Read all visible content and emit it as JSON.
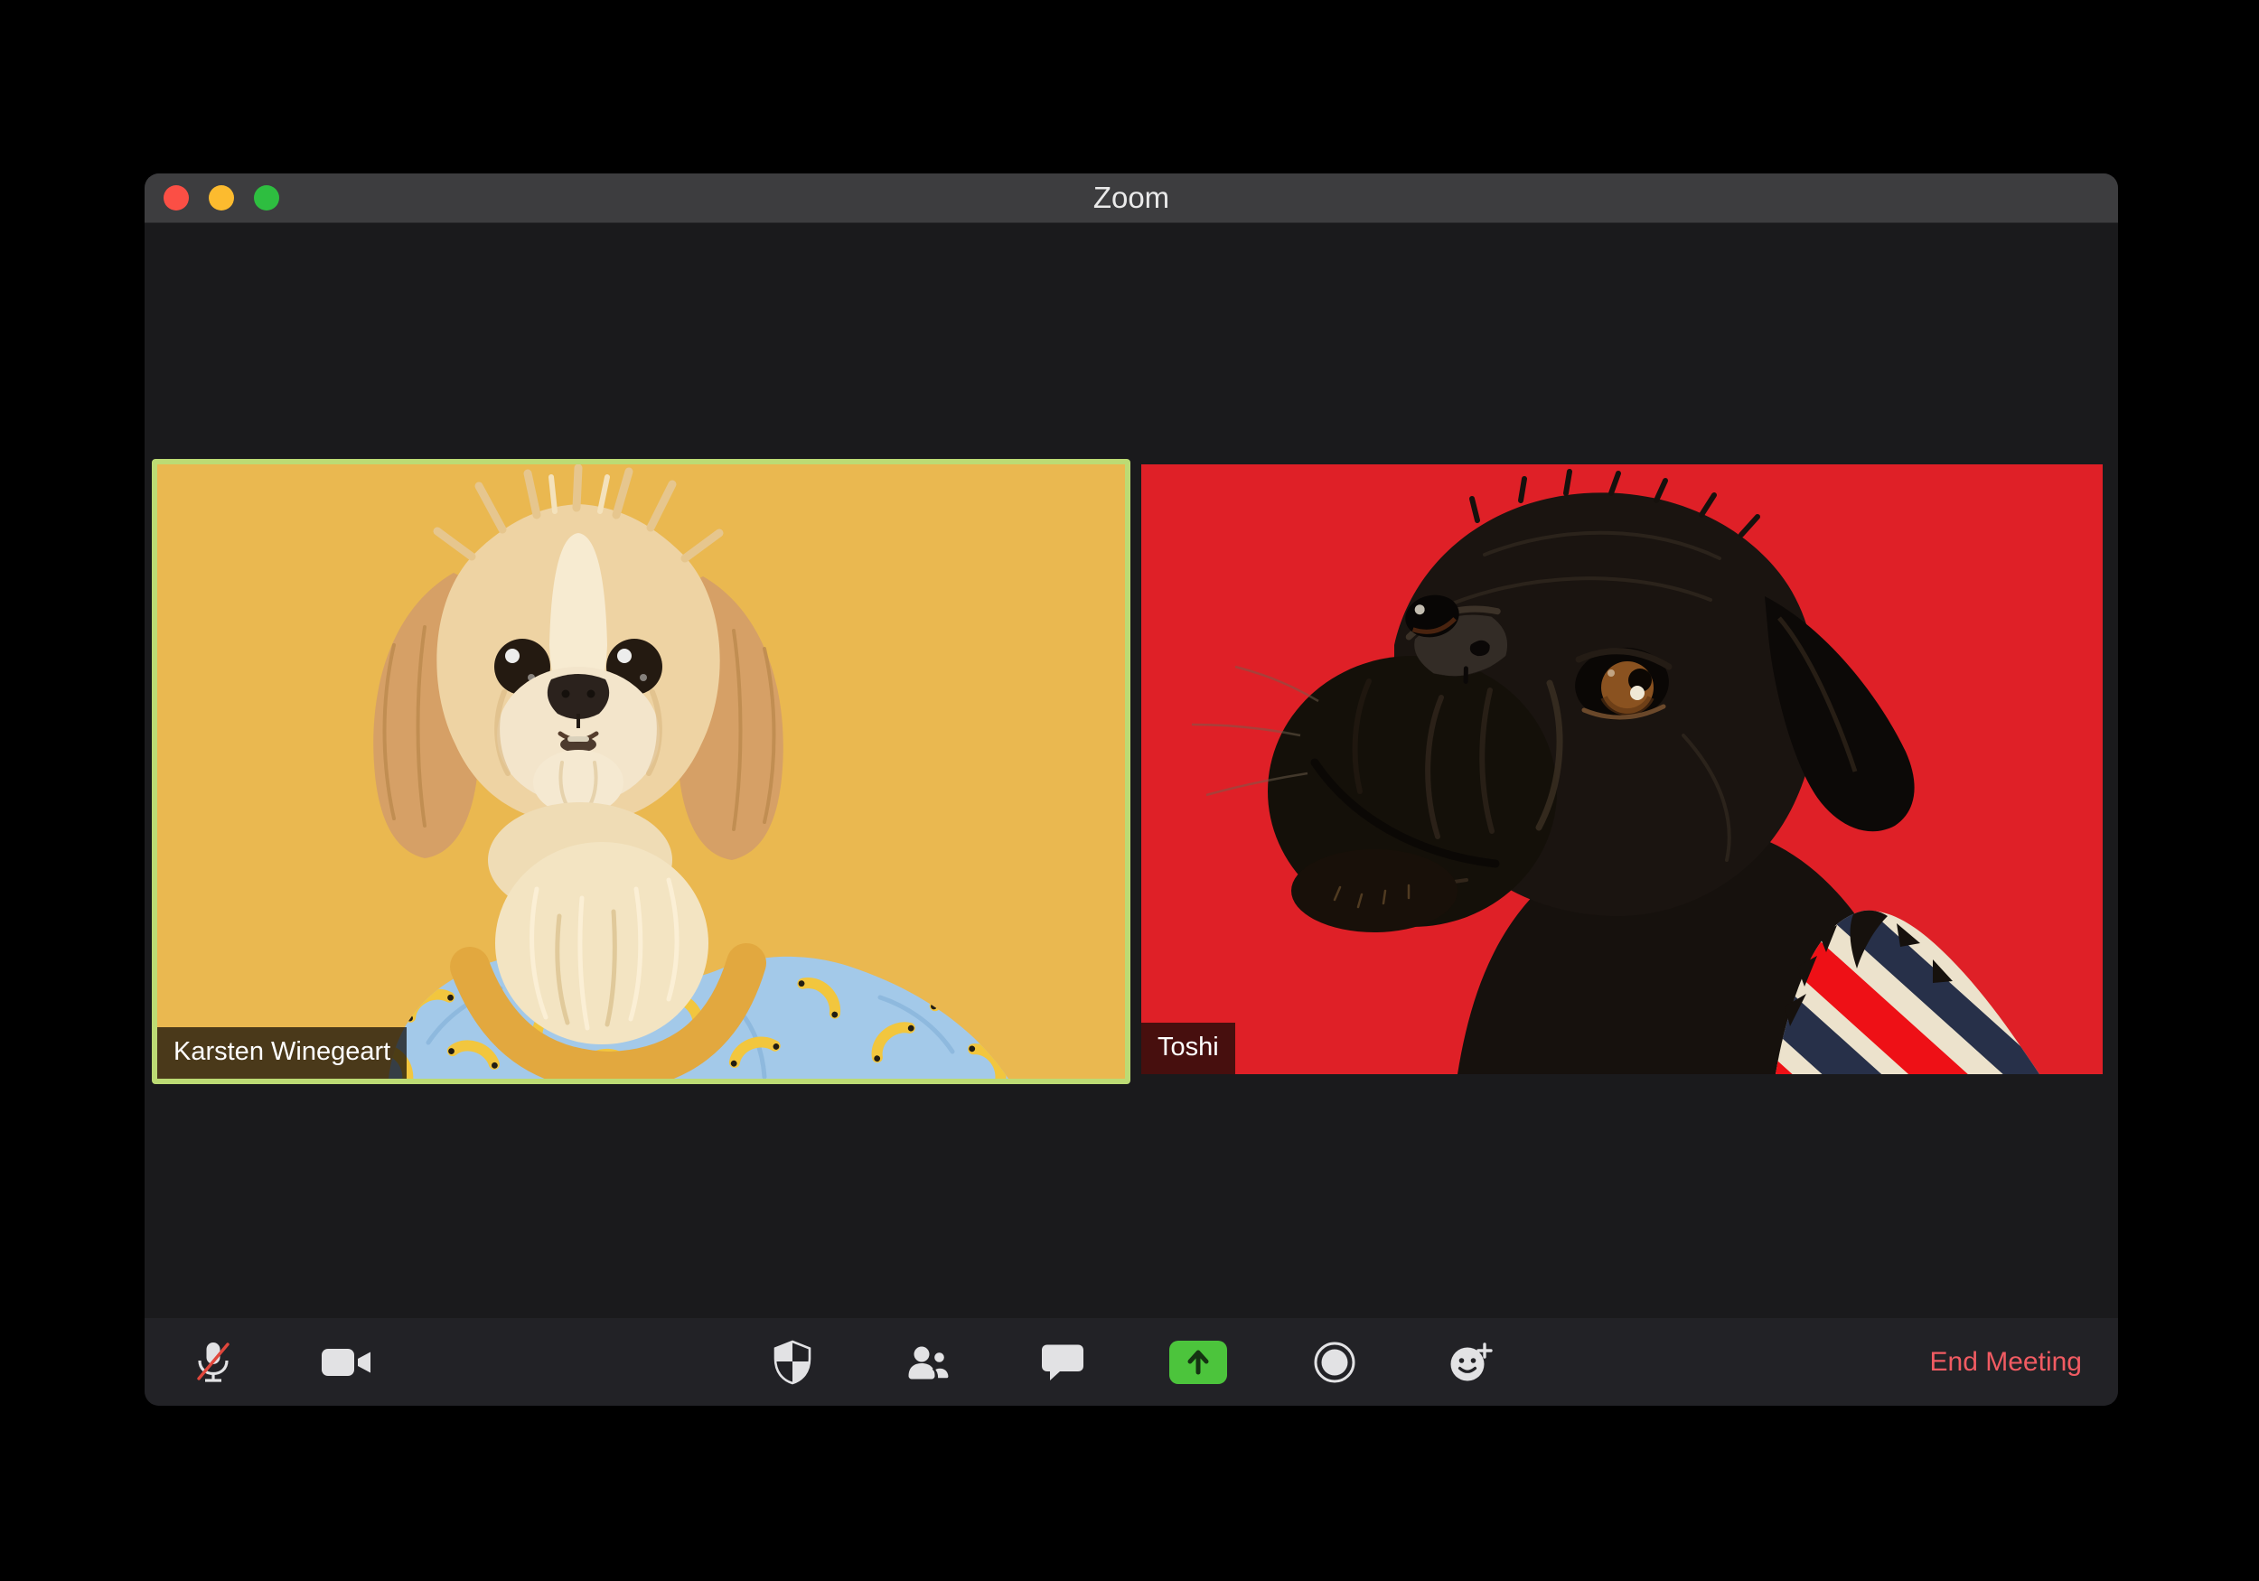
{
  "window": {
    "app_title": "Zoom",
    "traffic_lights": [
      {
        "name": "close",
        "color": "#fb4f45"
      },
      {
        "name": "minimize",
        "color": "#fcbb2f"
      },
      {
        "name": "fullscreen",
        "color": "#2ebe40"
      }
    ]
  },
  "participants": [
    {
      "name": "Karsten Winegeart",
      "active_speaker": true,
      "active_border_color": "#bcdb74",
      "camera_background": "#eab850"
    },
    {
      "name": "Toshi",
      "active_speaker": false,
      "camera_background": "#df2027"
    }
  ],
  "toolbar": {
    "buttons": [
      {
        "id": "mute",
        "icon": "mic-muted-icon",
        "state": "muted",
        "slash_color": "#e0473c"
      },
      {
        "id": "video",
        "icon": "video-camera-icon",
        "state": "on"
      },
      {
        "id": "security",
        "icon": "security-shield-icon"
      },
      {
        "id": "participants",
        "icon": "participants-icon"
      },
      {
        "id": "chat",
        "icon": "chat-bubble-icon"
      },
      {
        "id": "share-screen",
        "icon": "share-screen-icon",
        "accent_color": "#4cc43c"
      },
      {
        "id": "record",
        "icon": "record-icon"
      },
      {
        "id": "reactions",
        "icon": "reactions-smiley-icon"
      }
    ],
    "end_meeting_label": "End Meeting",
    "end_meeting_color": "#f15b62"
  }
}
